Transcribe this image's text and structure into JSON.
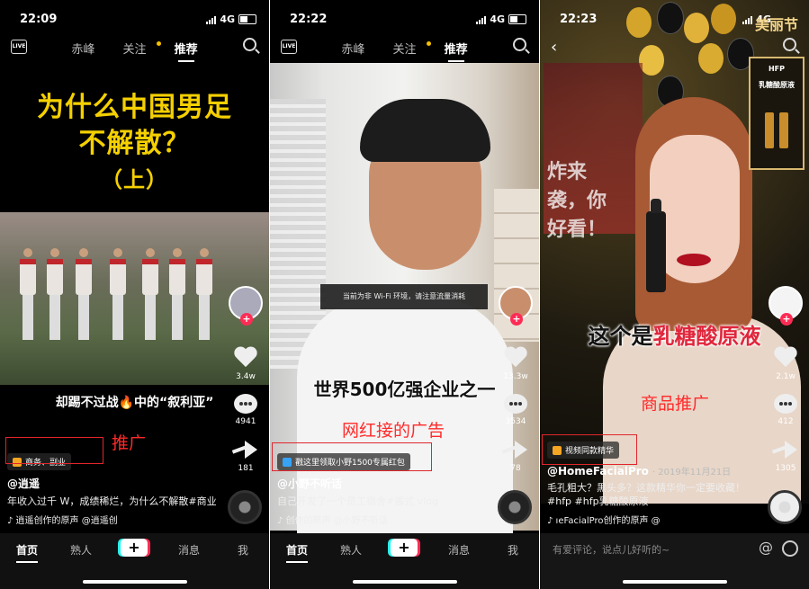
{
  "phones": [
    {
      "status": {
        "time": "22:09",
        "network": "4G"
      },
      "nav": {
        "live": "LIVE",
        "tabs": [
          "赤峰",
          "关注",
          "推荐"
        ]
      },
      "media": {
        "title_line1": "为什么中国男足",
        "title_line2": "不解散？",
        "title_line3": "（上）",
        "subtitle": "却踢不过战🔥中的“叙利亚”"
      },
      "rail": {
        "likes": "3.4w",
        "comments": "4941",
        "shares": "181"
      },
      "info": {
        "tag": "商务、副业",
        "handle": "@逍遥",
        "desc": "年收入过千 W，成绩稀烂，为什么不解散#商业",
        "music": "♪ 逍遥创作的原声    @逍遥创"
      },
      "annotation": "推广",
      "bottom": {
        "home": "首页",
        "friends": "熟人",
        "plus": "+",
        "inbox": "消息",
        "me": "我"
      }
    },
    {
      "status": {
        "time": "22:22",
        "network": "4G"
      },
      "nav": {
        "live": "LIVE",
        "tabs": [
          "赤峰",
          "关注",
          "推荐"
        ]
      },
      "media": {
        "toast": "当前为非 Wi-Fi 环境，请注意流量消耗",
        "caption": "世界500亿强企业之一"
      },
      "rail": {
        "likes": "13.3w",
        "comments": "3534",
        "shares": "78"
      },
      "info": {
        "tag": "戳这里领取小野1500专属红包",
        "handle": "@小野不听话",
        "desc": "自己开发了一个员工宿舍#酱式 vlog",
        "music": "♪ 创作的原声    @小野不听话"
      },
      "annotation": "网红接的广告",
      "bottom": {
        "home": "首页",
        "friends": "熟人",
        "plus": "+",
        "inbox": "消息",
        "me": "我"
      }
    },
    {
      "status": {
        "time": "22:23",
        "network": "4G"
      },
      "media": {
        "brand": "美丽节",
        "ad_card_line1": "HFP",
        "ad_card_line2": "乳糖酸原液",
        "banner_text": "炸来袭，你好看！",
        "caption_pre": "这个是",
        "caption_hl": "乳糖酸原液"
      },
      "rail": {
        "likes": "2.1w",
        "comments": "412",
        "shares": "1305"
      },
      "info": {
        "tag": "视频同款精华",
        "handle": "@HomeFacialPro",
        "date": "· 2019年11月21日",
        "desc": "毛孔粗大？黑头多？这款精华你一定要收藏！",
        "desc2": "#hfp #hfp乳糖酸原液",
        "music": "♪ ıeFacialPro创作的原声    @"
      },
      "annotation": "商品推广",
      "comment_placeholder": "有爱评论，说点儿好听的~"
    }
  ]
}
